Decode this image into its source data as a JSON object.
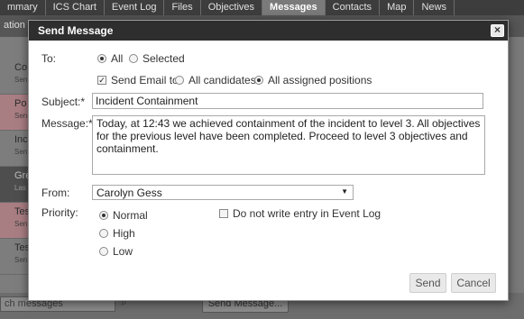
{
  "background": {
    "tabs": [
      "mmary",
      "ICS Chart",
      "Event Log",
      "Files",
      "Objectives",
      "Messages",
      "Contacts",
      "Map",
      "News"
    ],
    "active_tab": "Messages",
    "toolbar_text": "ation",
    "list_items": [
      {
        "title": "Co",
        "sub": "Sen"
      },
      {
        "title": "Po",
        "sub": "Sen"
      },
      {
        "title": "Inc",
        "sub": "Sen"
      },
      {
        "title": "Gre",
        "sub": "Las"
      },
      {
        "title": "Tes",
        "sub": "Sen"
      },
      {
        "title": "Tes",
        "sub": "Sen"
      }
    ],
    "search_placeholder": "ch messages",
    "search_icon": "magnifier-icon",
    "send_button": "Send Message..."
  },
  "dialog": {
    "title": "Send Message",
    "close_label": "×",
    "to": {
      "label": "To:",
      "options": [
        {
          "label": "All",
          "checked": true
        },
        {
          "label": "Selected",
          "checked": false
        }
      ]
    },
    "send_email": {
      "label": "Send Email to",
      "checked": true,
      "options": [
        {
          "label": "All candidates",
          "checked": false
        },
        {
          "label": "All assigned positions",
          "checked": true
        }
      ]
    },
    "subject": {
      "label": "Subject:*",
      "value": "Incident Containment"
    },
    "message": {
      "label": "Message:*",
      "value": "Today, at 12:43 we achieved containment of the incident to level 3. All objectives for the previous  level have been completed. Proceed to level 3 objectives and containment."
    },
    "from": {
      "label": "From:",
      "value": "Carolyn Gess",
      "caret": "▼"
    },
    "priority": {
      "label": "Priority:",
      "options": [
        {
          "label": "Normal",
          "checked": true
        },
        {
          "label": "High",
          "checked": false
        },
        {
          "label": "Low",
          "checked": false
        }
      ]
    },
    "no_log": {
      "label": "Do not write entry in Event Log",
      "checked": false
    },
    "buttons": {
      "send": "Send",
      "cancel": "Cancel"
    }
  }
}
